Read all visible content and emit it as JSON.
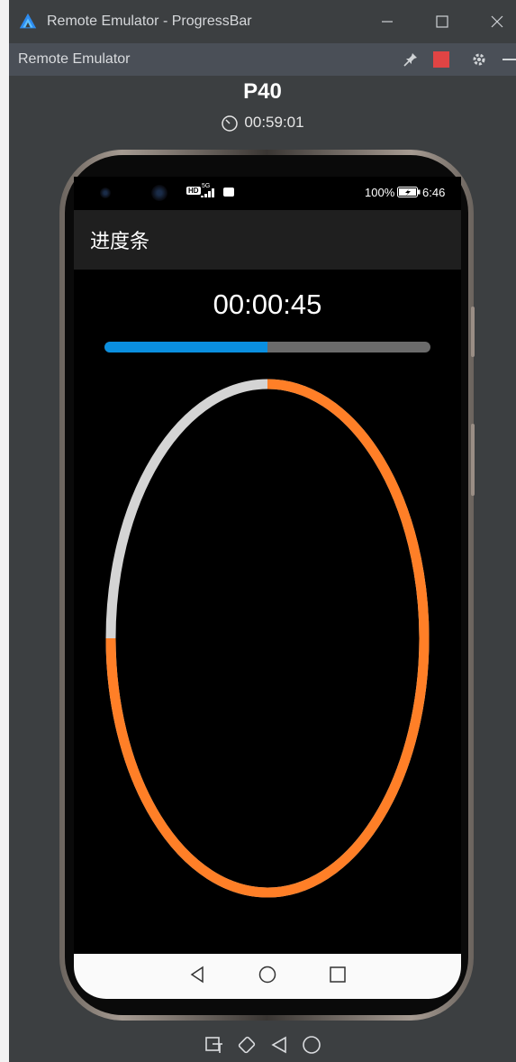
{
  "window": {
    "title": "Remote Emulator - ProgressBar",
    "minimize_icon": "minimize-icon",
    "maximize_icon": "maximize-icon",
    "close_icon": "close-icon"
  },
  "toolbar": {
    "title": "Remote Emulator",
    "icons": [
      "pin-icon",
      "stop-icon",
      "settings-icon",
      "collapse-icon"
    ],
    "stop_color": "#e04444"
  },
  "device": {
    "name": "P40",
    "session_time": "00:59:01"
  },
  "status_bar": {
    "hd_badge": "HD",
    "network": "5G",
    "battery": "100%",
    "time": "6:46"
  },
  "app": {
    "title": "进度条",
    "elapsed_time": "00:00:45",
    "linear_progress": 0.5,
    "ring_progress": 0.75,
    "colors": {
      "linear_fill": "#0a8fe0",
      "linear_track": "#6b6b6b",
      "ring_fill": "#ff7f27",
      "ring_track": "#d4d4d4"
    }
  },
  "nav_bar": {
    "icons": [
      "back-triangle-icon",
      "home-circle-icon",
      "recents-square-icon"
    ]
  },
  "emulator_controls": {
    "icons": [
      "screenshot-icon",
      "rotate-icon",
      "back-icon",
      "home-icon"
    ]
  }
}
